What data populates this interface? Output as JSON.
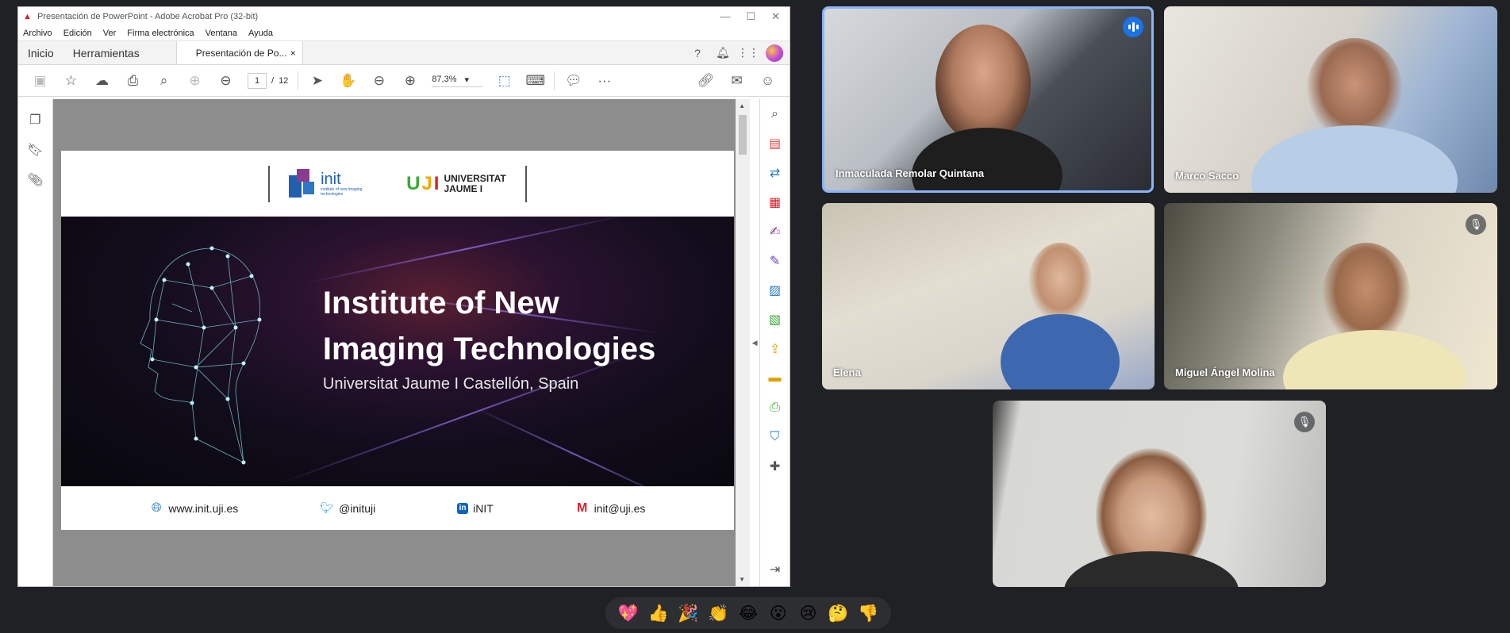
{
  "window": {
    "title": "Presentación de PowerPoint - Adobe Acrobat Pro (32-bit)",
    "controls": {
      "minimize": "—",
      "maximize": "☐",
      "close": "✕"
    }
  },
  "menu": [
    "Archivo",
    "Edición",
    "Ver",
    "Firma electrónica",
    "Ventana",
    "Ayuda"
  ],
  "tabs": {
    "home": "Inicio",
    "tools": "Herramientas",
    "document": "Presentación de Po...",
    "close": "×"
  },
  "toolbar": {
    "page_current": "1",
    "page_separator": "/",
    "page_total": "12",
    "zoom": "87,3%",
    "zoom_caret": "▾",
    "more": "···"
  },
  "slide": {
    "init_logo": {
      "name": "init",
      "tagline": "institute of new imaging technologies"
    },
    "uji_logo": {
      "mark_u": "U",
      "mark_j": "J",
      "mark_i": "I",
      "text_line1": "UNIVERSITAT",
      "text_line2": "JAUME I"
    },
    "title_line1": "Institute of New",
    "title_line2": "Imaging Technologies",
    "subtitle": "Universitat Jaume I Castellón, Spain",
    "contacts": [
      {
        "icon": "www-globe-icon",
        "text": "www.init.uji.es"
      },
      {
        "icon": "twitter-icon",
        "text": "@inituji"
      },
      {
        "icon": "linkedin-icon",
        "text": "iNIT"
      },
      {
        "icon": "gmail-icon",
        "text": "init@uji.es"
      }
    ]
  },
  "participants": [
    {
      "name": "Inmaculada Remolar Quintana",
      "speaking": true,
      "muted": false
    },
    {
      "name": "Marco Sacco",
      "speaking": false,
      "muted": false
    },
    {
      "name": "Elena",
      "speaking": false,
      "muted": false
    },
    {
      "name": "Miguel Ángel Molina",
      "speaking": false,
      "muted": true
    },
    {
      "name": "",
      "speaking": false,
      "muted": true
    }
  ],
  "reactions": [
    "💖",
    "👍",
    "🎉",
    "👏",
    "😂",
    "😮",
    "😢",
    "🤔",
    "👎"
  ],
  "colors": {
    "meet_bg": "#202124",
    "speaking_border": "#8ab4f8",
    "speaking_badge": "#1a73e8",
    "acrobat_red": "#d9232d"
  }
}
